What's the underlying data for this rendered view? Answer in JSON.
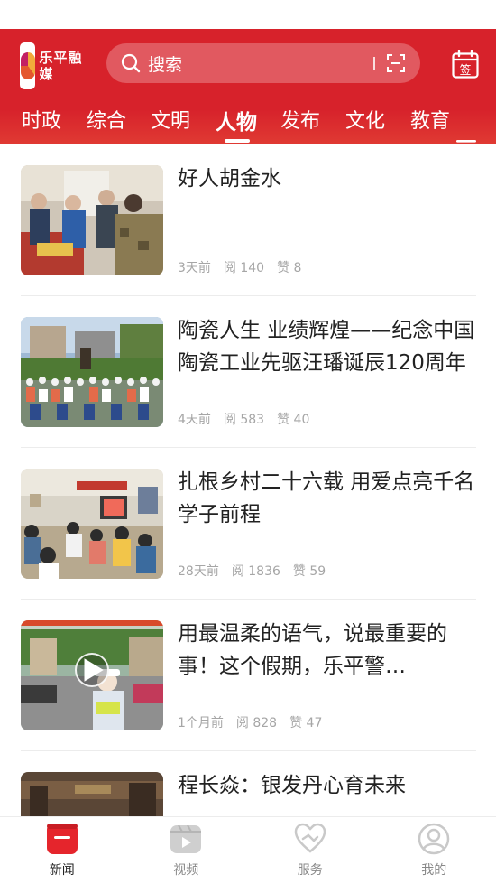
{
  "logo": {
    "name": "乐平融媒"
  },
  "search": {
    "placeholder": "搜索"
  },
  "calendar": {
    "label": "签"
  },
  "tabs": [
    {
      "label": "时政"
    },
    {
      "label": "综合"
    },
    {
      "label": "文明"
    },
    {
      "label": "人物",
      "active": true
    },
    {
      "label": "发布"
    },
    {
      "label": "文化"
    },
    {
      "label": "教育"
    }
  ],
  "articles": [
    {
      "title": "好人胡金水",
      "time": "3天前",
      "reads": "阅 140",
      "likes": "赞 8"
    },
    {
      "title": "陶瓷人生 业绩辉煌——纪念中国陶瓷工业先驱汪璠诞辰120周年",
      "time": "4天前",
      "reads": "阅 583",
      "likes": "赞 40"
    },
    {
      "title": "扎根乡村二十六载 用爱点亮千名学子前程",
      "time": "28天前",
      "reads": "阅 1836",
      "likes": "赞 59"
    },
    {
      "title": "用最温柔的语气，说最重要的事！这个假期，乐平警花“小……",
      "time": "1个月前",
      "reads": "阅 828",
      "likes": "赞 47",
      "video": true
    },
    {
      "title": "程长焱：银发丹心育未来",
      "time": "",
      "reads": "",
      "likes": ""
    }
  ],
  "bottom_nav": [
    {
      "label": "新闻",
      "active": true
    },
    {
      "label": "视频"
    },
    {
      "label": "服务"
    },
    {
      "label": "我的"
    }
  ],
  "colors": {
    "brand_red": "#d7222b",
    "meta_gray": "#a6a6a6"
  }
}
